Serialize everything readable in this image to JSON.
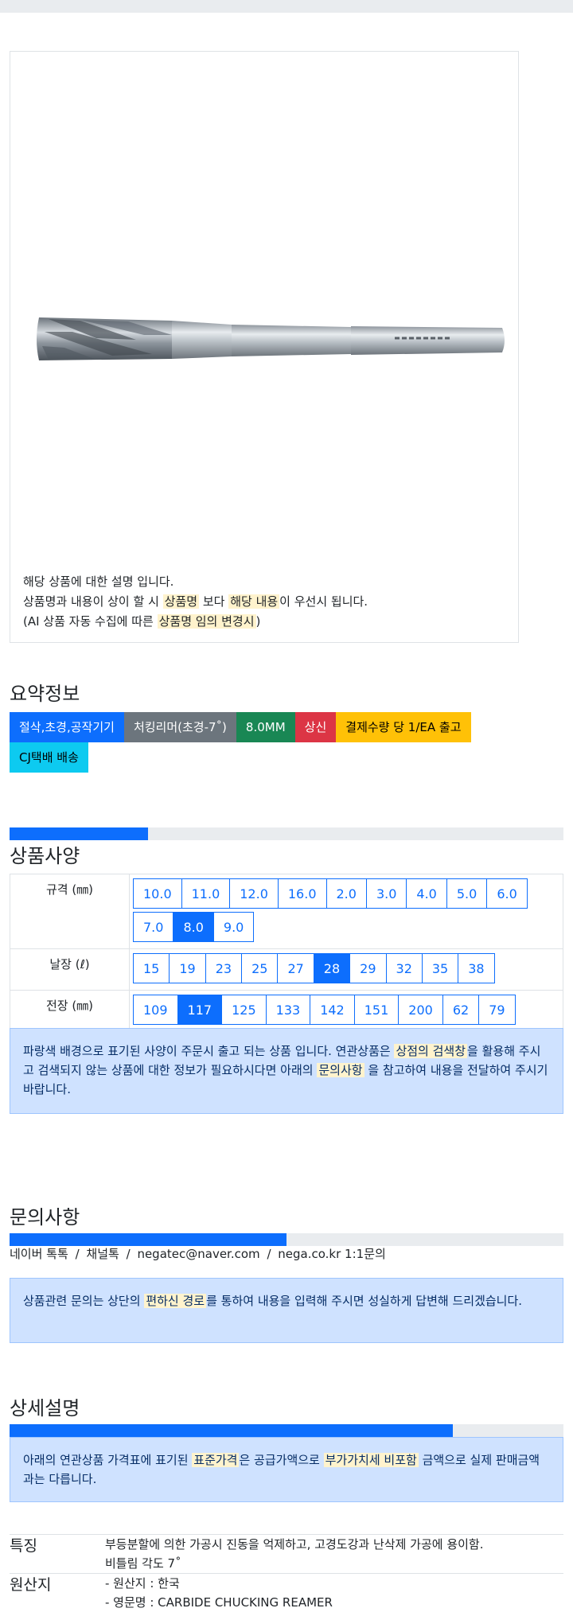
{
  "product": {
    "desc_line1": "해당 상품에 대한 설명 입니다.",
    "desc_line2_a": "상품명과 내용이 상이 할 시 ",
    "desc_line2_hl1": "상품명",
    "desc_line2_b": " 보다 ",
    "desc_line2_hl2": "해당 내용",
    "desc_line2_c": "이 우선시 됩니다.",
    "desc_line3_a": "(AI 상품 자동 수집에 따른 ",
    "desc_line3_hl": "상품명 임의 변경시",
    "desc_line3_b": ")"
  },
  "summary": {
    "title": "요약정보",
    "badges": [
      "절삭,초경,공작기기",
      "처킹리머(초경-7˚)",
      "8.0MM",
      "상신",
      "결제수량 당 1/EA 출고",
      "CJ택배 배송"
    ]
  },
  "spec": {
    "title": "상품사양",
    "progress": 0.25,
    "rows": [
      {
        "label": "규격 (㎜)",
        "options": [
          "10.0",
          "11.0",
          "12.0",
          "16.0",
          "2.0",
          "3.0",
          "4.0",
          "5.0",
          "6.0",
          "7.0",
          "8.0",
          "9.0"
        ],
        "selected": "8.0"
      },
      {
        "label": "날장 (ℓ)",
        "options": [
          "15",
          "19",
          "23",
          "25",
          "27",
          "28",
          "29",
          "32",
          "35",
          "38"
        ],
        "selected": "28"
      },
      {
        "label": "전장 (㎜)",
        "options": [
          "109",
          "117",
          "125",
          "133",
          "142",
          "151",
          "200",
          "62",
          "79"
        ],
        "selected": "117"
      }
    ],
    "notice_a": "파랑색 배경으로 표기된 사양이 주문시 출고 되는 상품 입니다. 연관상품은 ",
    "notice_hl1": "상점의 검색창",
    "notice_b": "을 활용해 주시고 검색되지 않는 상품에 대한 정보가 필요하시다면 아래의 ",
    "notice_hl2": "문의사항",
    "notice_c": " 을 참고하여 내용을 전달하여 주시기 바랍니다."
  },
  "inquiry": {
    "title": "문의사항",
    "progress": 0.5,
    "channels": [
      "네이버 톡톡",
      "채널톡",
      "negatec@naver.com",
      "nega.co.kr 1:1문의"
    ],
    "sep": "/",
    "notice_a": "상품관련 문의는 상단의 ",
    "notice_hl": "편하신 경로",
    "notice_b": "를 통하여 내용을 입력해 주시면 성실하게 답변해 드리겠습니다."
  },
  "detail": {
    "title": "상세설명",
    "progress": 0.8,
    "notice_a": "아래의 연관상품 가격표에 표기된 ",
    "notice_hl1": "표준가격",
    "notice_b": "은 공급가액으로 ",
    "notice_hl2": "부가가치세 비포함",
    "notice_c": " 금액으로 실제 판매금액과는 다릅니다.",
    "features": [
      {
        "key": "특징",
        "lines": [
          "부등분할에 의한 가공시 진동을 억제하고, 고경도강과 난삭제 가공에 용이함.",
          "비틀림 각도 7˚"
        ]
      },
      {
        "key": "원산지",
        "lines": [
          "- 원산지 : 한국",
          "- 영문명 : CARBIDE CHUCKING REAMER"
        ]
      }
    ]
  }
}
